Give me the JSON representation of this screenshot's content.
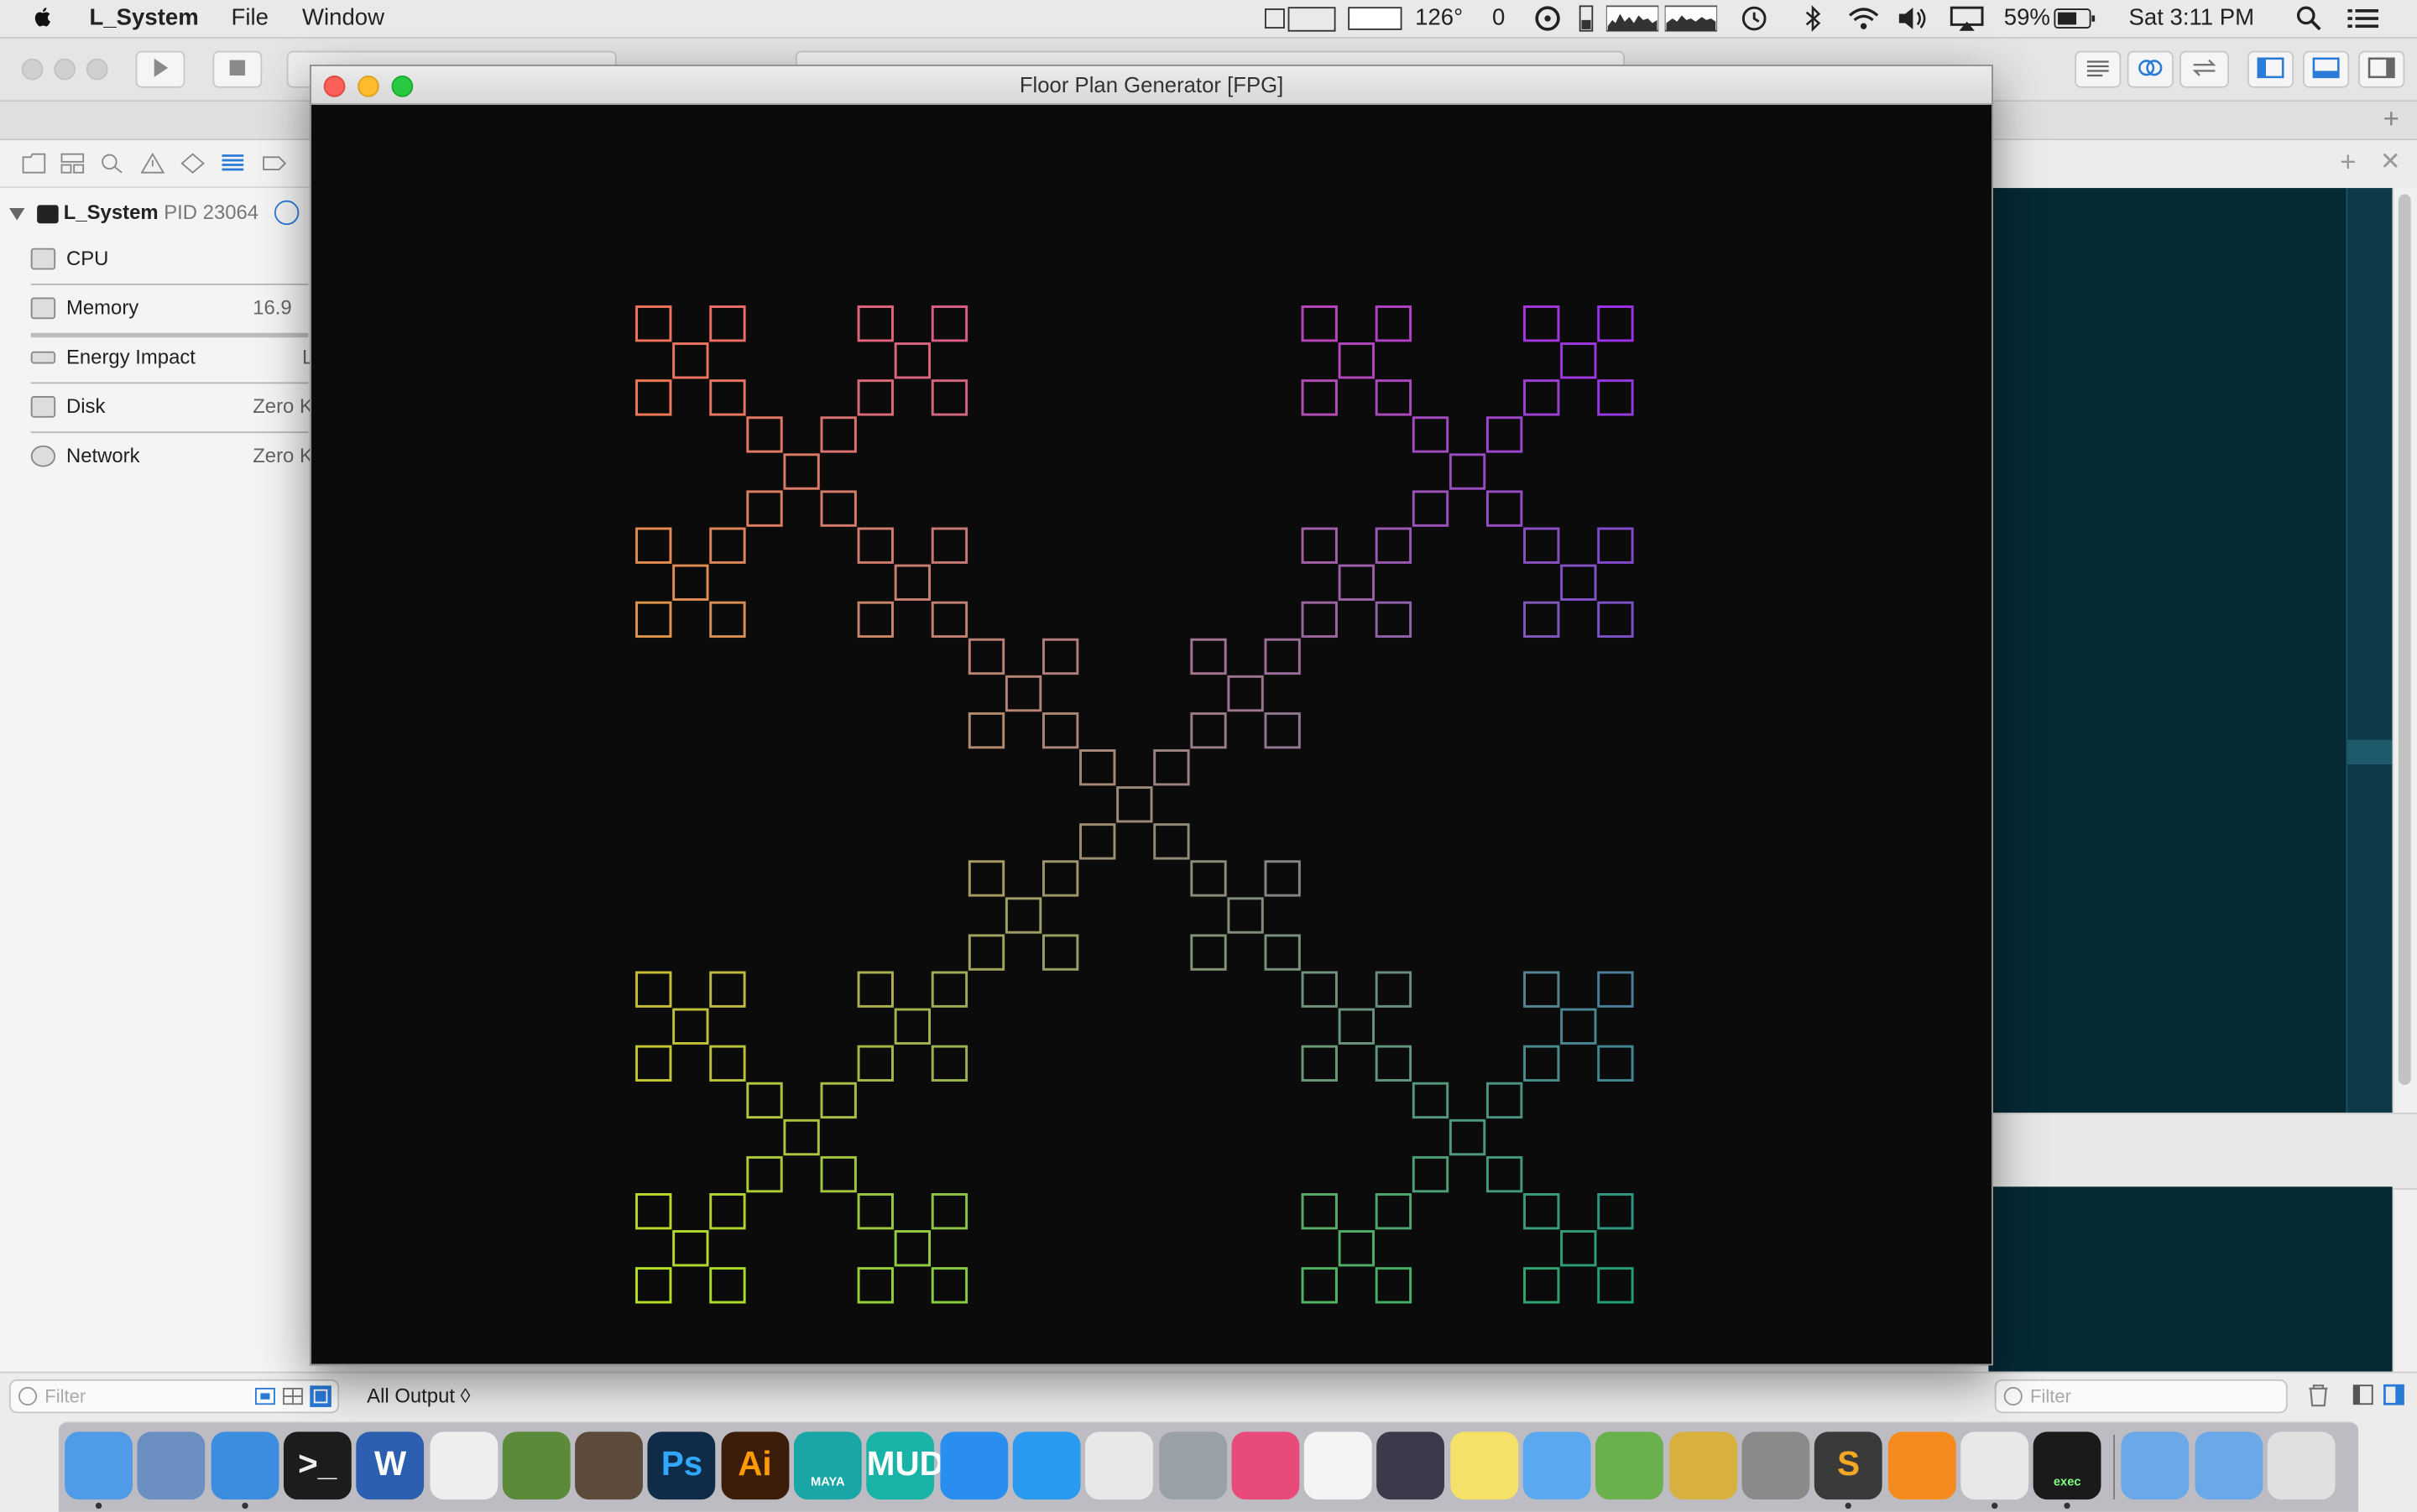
{
  "menubar": {
    "app_name": "L_System",
    "menus": [
      "File",
      "Window"
    ],
    "status": {
      "temperature": "126°",
      "counter": "0",
      "battery": "59%",
      "clock": "Sat 3:11 PM"
    }
  },
  "navigator": {
    "process_name": "L_System",
    "process_pid": "PID 23064",
    "gauges": [
      {
        "label": "CPU",
        "value": ""
      },
      {
        "label": "Memory",
        "value": "16.9"
      },
      {
        "label": "Energy Impact",
        "value": "L"
      },
      {
        "label": "Disk",
        "value": "Zero K"
      },
      {
        "label": "Network",
        "value": "Zero K"
      }
    ]
  },
  "filters": {
    "left_placeholder": "Filter",
    "right_placeholder": "Filter"
  },
  "console": {
    "output_selector": "All Output ◊"
  },
  "fpg_window": {
    "title": "Floor Plan Generator [FPG]"
  },
  "fractal": {
    "description_colors": [
      "#f4725b",
      "#ee4fa4",
      "#a030e8",
      "#6a1fe0",
      "#f6a33a",
      "#e7d629",
      "#34b66a",
      "#2a4fd8",
      "#b5e026",
      "#6fd42a",
      "#24a078",
      "#1f6fd0"
    ]
  },
  "dock": {
    "apps": [
      "finder-icon",
      "preview-icon",
      "xcode-icon",
      "terminal-icon",
      "word-icon",
      "unity-icon",
      "minecraft-icon",
      "pen-tool-icon",
      "photoshop-icon",
      "illustrator-icon",
      "maya-icon",
      "mudbox-icon",
      "app-store-icon",
      "safari-icon",
      "chrome-icon",
      "system-monitor-icon",
      "itunes-icon",
      "photos-icon",
      "dashboard-icon",
      "notes-icon",
      "messages-icon",
      "maps-icon",
      "quill-icon",
      "system-preferences-icon",
      "sublime-text-icon",
      "vlc-icon",
      "sync-icon",
      "exec-icon",
      "applications-folder-icon",
      "downloads-folder-icon",
      "trash-icon"
    ],
    "labels": {
      "photoshop": "Ps",
      "illustrator": "Ai",
      "word": "W",
      "maya": "MAYA",
      "mudbox": "MUD",
      "sublime": "S",
      "exec": "exec"
    }
  }
}
